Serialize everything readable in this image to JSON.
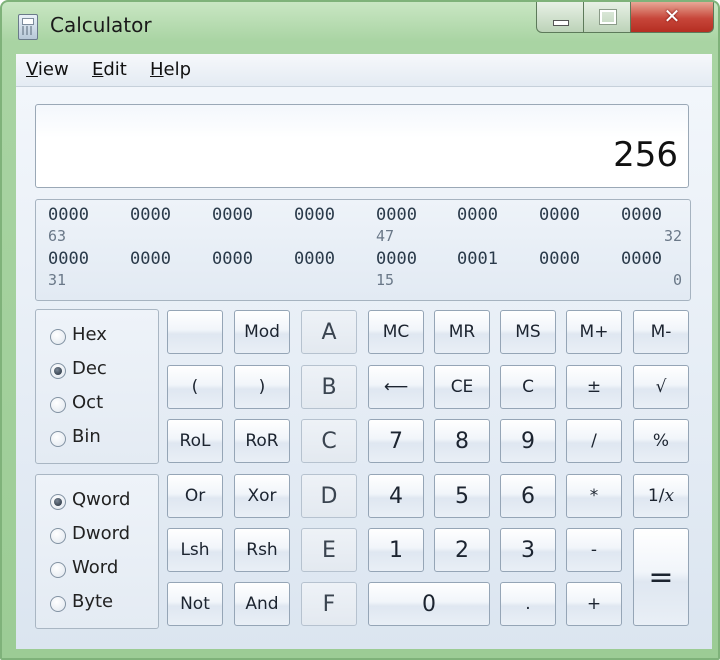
{
  "window": {
    "title": "Calculator",
    "controls": {
      "minimize": "minimize-icon",
      "maximize": "maximize-icon",
      "close": "✕"
    }
  },
  "menu": [
    {
      "label": "View",
      "accel": "V",
      "rest": "iew"
    },
    {
      "label": "Edit",
      "accel": "E",
      "rest": "dit"
    },
    {
      "label": "Help",
      "accel": "H",
      "rest": "elp"
    }
  ],
  "display": {
    "value": "256"
  },
  "bits": {
    "row1": [
      "0000",
      "0000",
      "0000",
      "0000",
      "0000",
      "0000",
      "0000",
      "0000"
    ],
    "row1_positions": [
      "63",
      "47",
      "32"
    ],
    "row2": [
      "0000",
      "0000",
      "0000",
      "0000",
      "0000",
      "0001",
      "0000",
      "0000"
    ],
    "row2_positions": [
      "31",
      "15",
      "0"
    ]
  },
  "base": {
    "options": [
      "Hex",
      "Dec",
      "Oct",
      "Bin"
    ],
    "selected": "Dec"
  },
  "word_size": {
    "options": [
      "Qword",
      "Dword",
      "Word",
      "Byte"
    ],
    "selected": "Qword"
  },
  "buttons": {
    "r1": [
      "",
      "Mod",
      "A",
      "MC",
      "MR",
      "MS",
      "M+",
      "M-"
    ],
    "r2": [
      "(",
      ")",
      "B",
      "⟵",
      "CE",
      "C",
      "±",
      "√"
    ],
    "r3": [
      "RoL",
      "RoR",
      "C",
      "7",
      "8",
      "9",
      "/",
      "%"
    ],
    "r4": [
      "Or",
      "Xor",
      "D",
      "4",
      "5",
      "6",
      "*",
      "1/x"
    ],
    "r5": [
      "Lsh",
      "Rsh",
      "E",
      "1",
      "2",
      "3",
      "-"
    ],
    "r6": [
      "Not",
      "And",
      "F",
      "0",
      ".",
      "+"
    ],
    "equals": "="
  }
}
